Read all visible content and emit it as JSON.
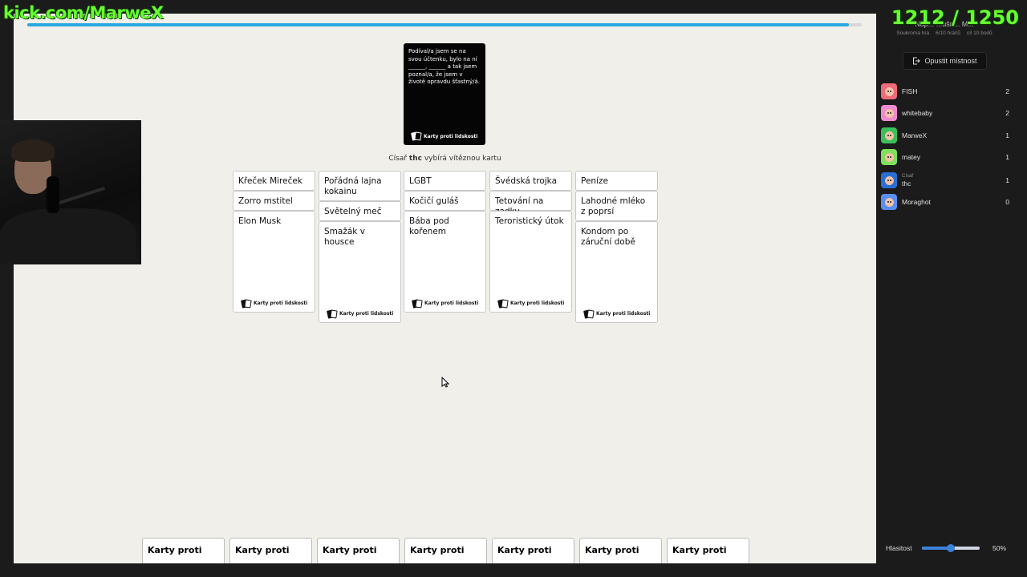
{
  "overlay": {
    "channel": "kick.com/MarweX",
    "counter": "1212 / 1250"
  },
  "game": {
    "progress": 0.985,
    "black_card": {
      "text": "Podíval/a jsem se na svou účtenku, bylo na ní ______, ______ a tak jsem poznal/a, že jsem v životě opravdu šťastný/á.",
      "logo": "Karty proti lidskosti"
    },
    "czar_status": {
      "prefix": "Císař",
      "name": "thc",
      "suffix": "vybírá vítěznou kartu"
    },
    "played_sets": [
      {
        "cards": [
          "Křeček Mireček",
          "Zorro mstitel",
          "Elon Musk"
        ],
        "logo": "Karty proti lidskosti"
      },
      {
        "cards": [
          "Pořádná lajna kokainu",
          "Světelný meč",
          "Smažák v housce"
        ],
        "logo": "Karty proti lidskosti"
      },
      {
        "cards": [
          "LGBT",
          "Kočičí guláš",
          "Bába pod kořenem"
        ],
        "logo": "Karty proti lidskosti"
      },
      {
        "cards": [
          "Švédská trojka",
          "Tetování na zadku",
          "Teroristický útok"
        ],
        "logo": "Karty proti lidskosti"
      },
      {
        "cards": [
          "Peníze",
          "Lahodné mléko z poprsí",
          "Kondom po záruční době"
        ],
        "logo": "Karty proti lidskosti"
      }
    ],
    "hand": [
      "Karty proti",
      "Karty proti",
      "Karty proti",
      "Karty proti",
      "Karty proti",
      "Karty proti",
      "Karty proti"
    ]
  },
  "sidebar": {
    "room_title": "Nap... ...ušn... M...",
    "room_meta": [
      "Soukromá hra",
      "6/10 hráčů",
      "cíl 10 bodů"
    ],
    "leave_button": "Opustit místnost",
    "players": [
      {
        "name": "FISH",
        "score": "2",
        "role": "",
        "color": "#f06a7a"
      },
      {
        "name": "whitebaby",
        "score": "2",
        "role": "",
        "color": "#f08ad0"
      },
      {
        "name": "MarweX",
        "score": "1",
        "role": "",
        "color": "#3bbf5a"
      },
      {
        "name": "matey",
        "score": "1",
        "role": "",
        "color": "#7ee05a"
      },
      {
        "name": "thc",
        "score": "1",
        "role": "Císař",
        "color": "#2a6fd6"
      },
      {
        "name": "Moraghot",
        "score": "0",
        "role": "",
        "color": "#5a8ef0"
      }
    ],
    "volume": {
      "label": "Hlasitost",
      "value": 0.5,
      "text": "50%"
    }
  }
}
